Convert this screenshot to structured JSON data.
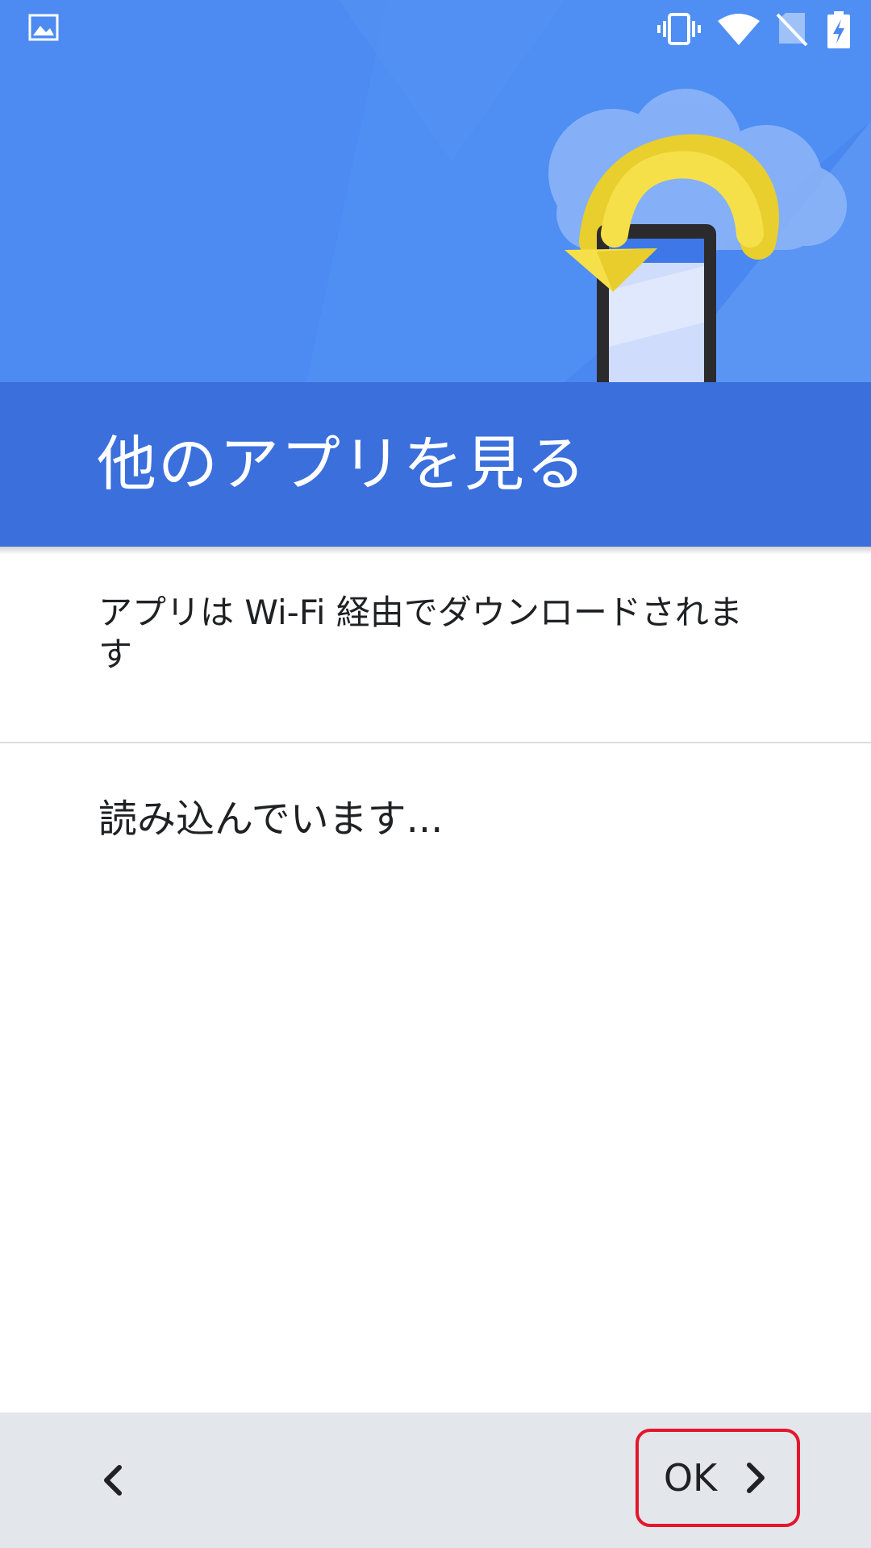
{
  "status_bar": {
    "icons": [
      "image-notification-icon",
      "vibrate-icon",
      "wifi-icon",
      "no-sim-icon",
      "battery-charging-icon"
    ]
  },
  "header": {
    "title": "他のアプリを見る",
    "illustration": "phone-restore-cloud-illustration",
    "colors": {
      "background": "#4a87f0",
      "band": "#3a6fdc",
      "arrow": "#f6e04a"
    }
  },
  "content": {
    "wifi_notice": "アプリは Wi-Fi 経由でダウンロードされます",
    "loading": "読み込んでいます..."
  },
  "nav": {
    "back_icon": "chevron-left-icon",
    "ok_label": "OK",
    "ok_icon": "chevron-right-icon",
    "highlight_color": "#e3162d"
  }
}
